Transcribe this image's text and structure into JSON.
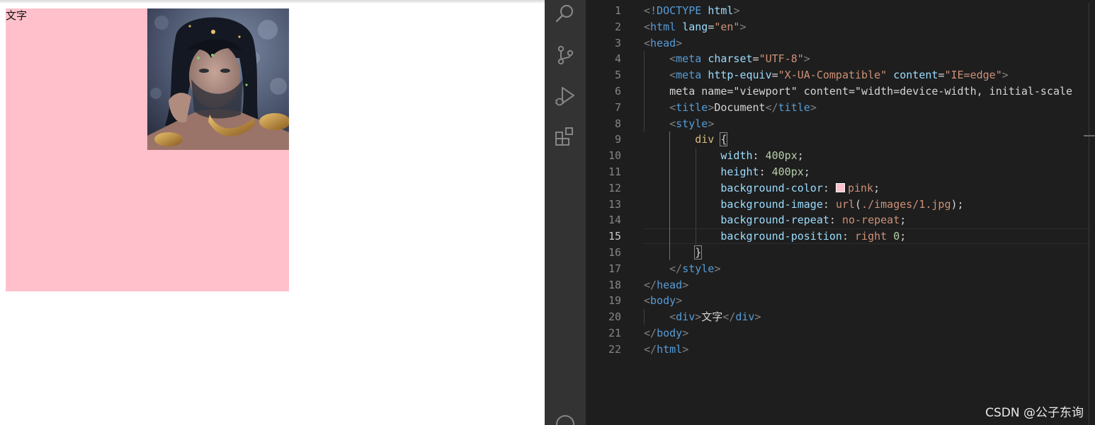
{
  "preview": {
    "div_text": "文字",
    "div_background_color": "#ffc0cb",
    "background_image": "portrait"
  },
  "activity_bar": {
    "icons": [
      "search-icon",
      "source-control-icon",
      "run-debug-icon",
      "extensions-icon",
      "account-icon"
    ]
  },
  "editor": {
    "current_line": 15,
    "line_numbers": [
      "1",
      "2",
      "3",
      "4",
      "5",
      "6",
      "7",
      "8",
      "9",
      "10",
      "11",
      "12",
      "13",
      "14",
      "15",
      "16",
      "17",
      "18",
      "19",
      "20",
      "21",
      "22"
    ],
    "lines": [
      "<!DOCTYPE html>",
      "<html lang=\"en\">",
      "<head>",
      "    <meta charset=\"UTF-8\">",
      "    <meta http-equiv=\"X-UA-Compatible\" content=\"IE=edge\">",
      "    <meta name=\"viewport\" content=\"width=device-width, initial-scale",
      "    <title>Document</title>",
      "    <style>",
      "        div {",
      "            width: 400px;",
      "            height: 400px;",
      "            background-color: pink;",
      "            background-image: url(./images/1.jpg);",
      "            background-repeat: no-repeat;",
      "            background-position: right 0;",
      "        }",
      "    </style>",
      "</head>",
      "<body>",
      "    <div>文字</div>",
      "</body>",
      "</html>"
    ]
  },
  "watermark": "CSDN @公子东询"
}
